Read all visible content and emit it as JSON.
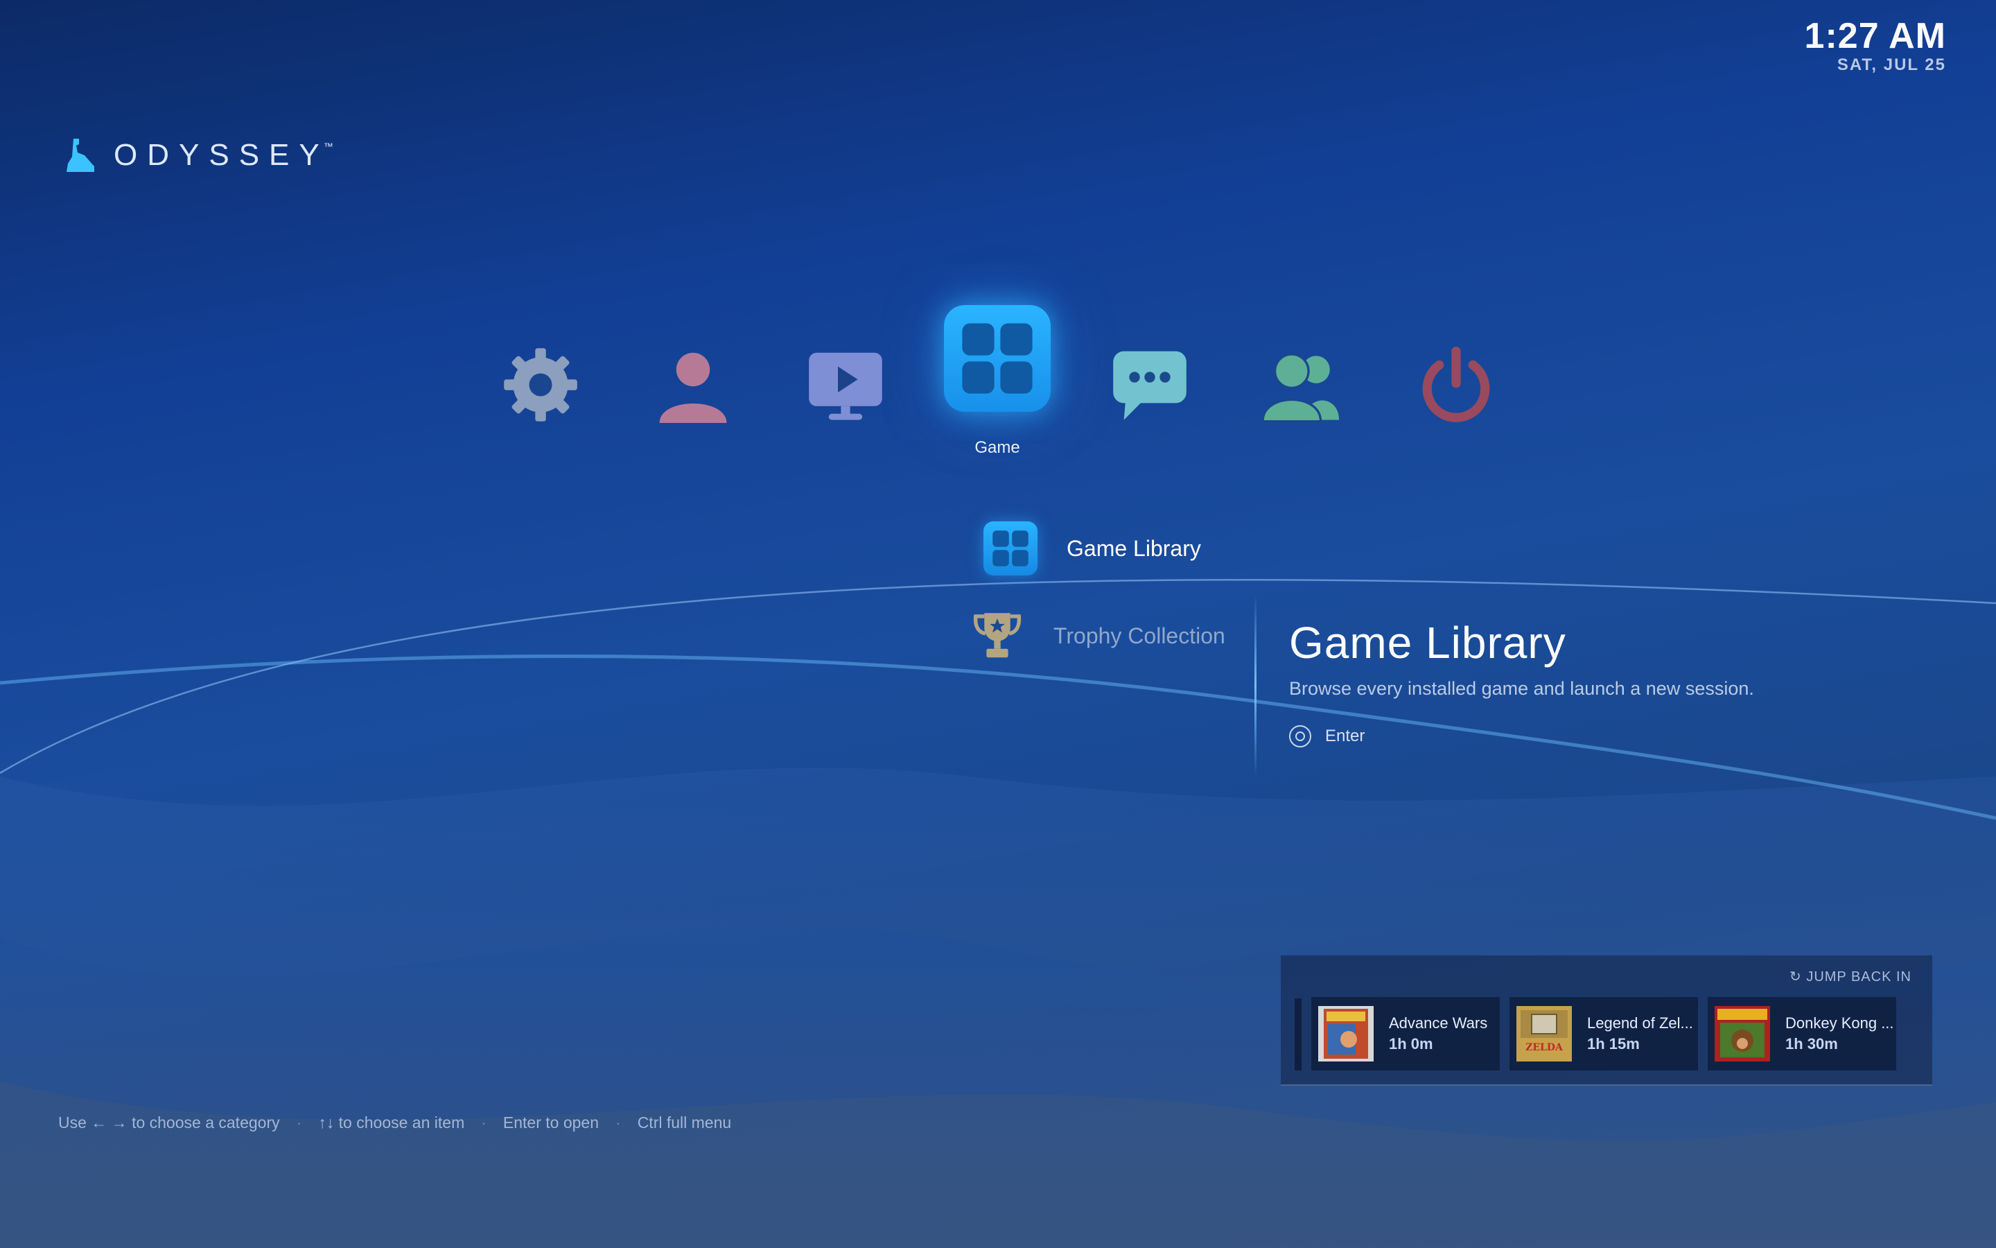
{
  "clock": {
    "time": "1:27 AM",
    "date": "SAT, JUL 25"
  },
  "brand": {
    "name": "ODYSSEY",
    "trademark": "™"
  },
  "categories": [
    {
      "id": "settings",
      "icon": "gear-icon",
      "color": "#8d9fbe"
    },
    {
      "id": "users",
      "icon": "user-icon",
      "color": "#b67a97"
    },
    {
      "id": "video",
      "icon": "monitor-play-icon",
      "color": "#7f8fd6"
    },
    {
      "id": "game",
      "icon": "grid-icon",
      "color": "#2aa8f8",
      "label": "Game",
      "selected": true
    },
    {
      "id": "chat",
      "icon": "chat-icon",
      "color": "#72c3cf"
    },
    {
      "id": "friends",
      "icon": "friends-icon",
      "color": "#5db095"
    },
    {
      "id": "power",
      "icon": "power-icon",
      "color": "#9a4a5e"
    }
  ],
  "items": [
    {
      "label": "Game Library",
      "icon": "grid-icon",
      "active": true
    },
    {
      "label": "Trophy Collection",
      "icon": "trophy-icon",
      "active": false
    }
  ],
  "detail": {
    "title": "Game Library",
    "description": "Browse every installed game and launch a new session.",
    "action_label": "Enter"
  },
  "jump_back_in": {
    "header": "↻ JUMP BACK IN",
    "games": [
      {
        "title": "Advance Wars",
        "time": "1h 0m"
      },
      {
        "title": "Legend of Zel...",
        "time": "1h 15m"
      },
      {
        "title": "Donkey Kong ...",
        "time": "1h 30m"
      }
    ]
  },
  "hints": {
    "category": "Use ← → to choose a category",
    "item": "↑↓ to choose an item",
    "open": "Enter to open",
    "menu": "Ctrl full menu",
    "separator": "·"
  },
  "colors": {
    "accent": "#2aa8f8",
    "background": "#123f95"
  }
}
